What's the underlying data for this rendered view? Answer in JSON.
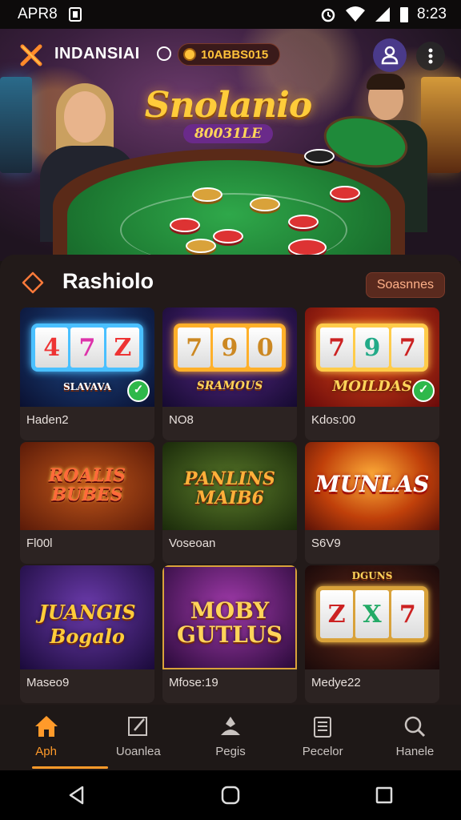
{
  "status_bar": {
    "carrier": "APR8",
    "time": "8:23"
  },
  "header": {
    "brand": "INDANSIAI",
    "coins": "10ABBS015"
  },
  "banner": {
    "title": "Snolanio",
    "subtitle": "80031LE"
  },
  "section": {
    "title": "Rashiolo",
    "see_all": "Soasnnes"
  },
  "games": [
    {
      "label": "Haden2",
      "title": "SLAVAVA",
      "reels": [
        "4",
        "7",
        "Z"
      ],
      "verified": true
    },
    {
      "label": "NO8",
      "title": "SRAMOUS",
      "reels": [
        "7",
        "9",
        "0"
      ],
      "verified": false
    },
    {
      "label": "Kdos:00",
      "title": "MOILDAS",
      "reels": [
        "7",
        "9",
        "7"
      ],
      "verified": true
    },
    {
      "label": "Fl00l",
      "title": "ROALIS BUBES",
      "reels": [],
      "verified": false
    },
    {
      "label": "Voseoan",
      "title": "PANLINS MAIB6",
      "reels": [],
      "verified": false
    },
    {
      "label": "S6V9",
      "title": "MUNLAS",
      "reels": [],
      "verified": false
    },
    {
      "label": "Maseo9",
      "title": "JUANGIS Bogalo",
      "reels": [],
      "verified": false
    },
    {
      "label": "Mfose:19",
      "title": "MOBY GUTLUS",
      "reels": [],
      "verified": false
    },
    {
      "label": "Medye22",
      "title": "DGUNS",
      "reels": [
        "Z",
        "X",
        "7"
      ],
      "verified": false
    }
  ],
  "nav": [
    {
      "label": "Aph",
      "icon": "home-icon",
      "active": true
    },
    {
      "label": "Uoanlea",
      "icon": "edit-icon",
      "active": false
    },
    {
      "label": "Pegis",
      "icon": "poker-icon",
      "active": false
    },
    {
      "label": "Pecelor",
      "icon": "clipboard-icon",
      "active": false
    },
    {
      "label": "Hanele",
      "icon": "search-icon",
      "active": false
    }
  ],
  "colors": {
    "accent": "#ff9a2a",
    "background": "#1b1514",
    "card": "#2c2322",
    "gold": "#ffcc3a"
  }
}
